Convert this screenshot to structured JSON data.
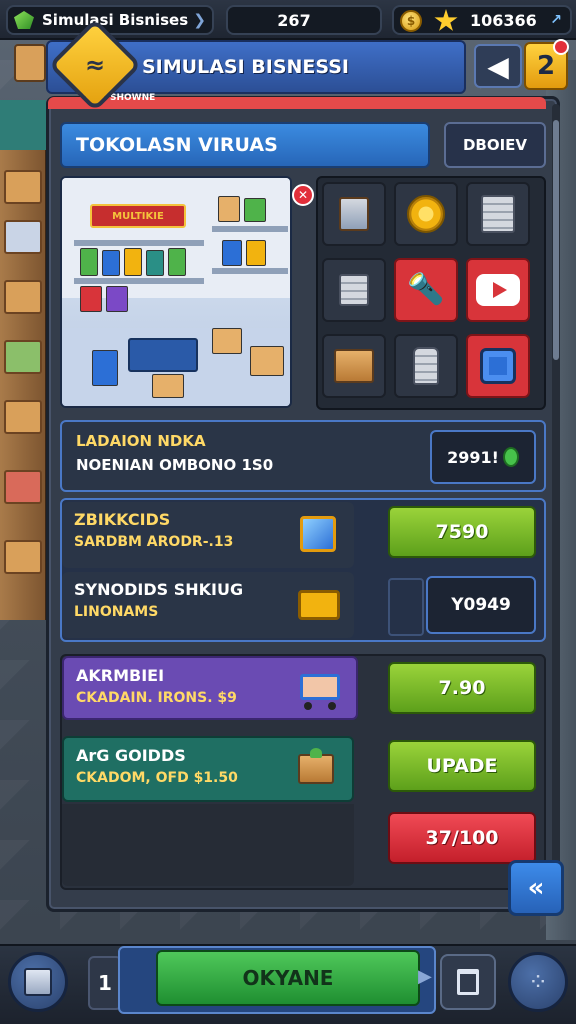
{
  "top_bar": {
    "game_name": "Simulasi Bisnises",
    "level": "267",
    "coins": "106366"
  },
  "header": {
    "title": "SIMULASI BISNESSI",
    "logo_text": "≈",
    "badge_text": "2",
    "sub_strip": "SHOWNE"
  },
  "store": {
    "title": "TOKOLASN VIRUAS",
    "review_label": "DBOIEV",
    "sign_text": "MULTIKIE"
  },
  "item_grid": {
    "items": [
      {
        "name": "crate-icon",
        "style": "dark"
      },
      {
        "name": "gear-icon",
        "style": "dark"
      },
      {
        "name": "server-icon",
        "style": "dark"
      },
      {
        "name": "server-icon",
        "style": "dark"
      },
      {
        "name": "flashlight-icon",
        "style": "red"
      },
      {
        "name": "play-icon",
        "style": "red"
      },
      {
        "name": "crate-icon",
        "style": "dark"
      },
      {
        "name": "bottle-icon",
        "style": "dark"
      },
      {
        "name": "camera-icon",
        "style": "red"
      }
    ]
  },
  "info": {
    "line1": "LADAION NDKA",
    "line2": "NOENIAN OMBONO 1S0",
    "value": "2991!"
  },
  "upgrades": [
    {
      "title": "ZBIKKCIDS",
      "subtitle": "SARDBM ARODR-.13",
      "button": "7590",
      "icon": "machine-icon"
    },
    {
      "title": "SYNODIDS SHKIUG",
      "subtitle": "LINONAMS",
      "button": "Y0949",
      "icon": "parts-icon"
    },
    {
      "title": "AKRMBIEI",
      "subtitle": "CKADAIN. IRONS. $9",
      "button": "7.90",
      "icon": "cart-icon"
    },
    {
      "title": "ArG GOIDDS",
      "subtitle": "CKADOM, OFD $1.50",
      "button": "UPADE",
      "icon": "crate-cart-icon"
    }
  ],
  "actions": {
    "price_red": "37/100",
    "collapse": "«"
  },
  "bottom_bar": {
    "tab_number": "1",
    "main_action": "OKYANE"
  },
  "colors": {
    "accent_blue": "#3b8be0",
    "action_green": "#5da01b",
    "alert_red": "#d8343a",
    "gold": "#ffd23f"
  }
}
